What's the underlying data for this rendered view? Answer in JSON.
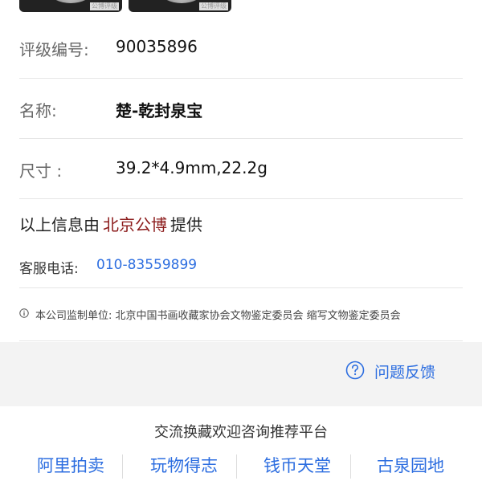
{
  "thumbnails": [
    {
      "watermark": "公博评级"
    },
    {
      "watermark": "公博评级"
    }
  ],
  "details": {
    "grade_label": "评级编号:",
    "grade_value": "90035896",
    "name_label": "名称:",
    "name_value": "楚-乾封泉宝",
    "size_label": "尺寸 :",
    "size_value": "39.2*4.9mm,22.2g"
  },
  "provider": {
    "prefix": "以上信息由",
    "org": "北京公博",
    "suffix": "提供"
  },
  "service": {
    "label": "客服电话:",
    "phone": "010-83559899"
  },
  "supervision": {
    "icon": "info-icon",
    "text": "本公司监制单位: 北京中国书画收藏家协会文物鉴定委员会 缩写文物鉴定委员会"
  },
  "feedback": {
    "icon": "question-circle-icon",
    "label": "问题反馈"
  },
  "footer": {
    "title": "交流换藏欢迎咨询推荐平台",
    "links": [
      "阿里拍卖",
      "玩物得志",
      "钱币天堂",
      "古泉园地"
    ]
  },
  "colors": {
    "link_blue": "#2d6ee0",
    "org_red": "#8b1a1a",
    "band_gray": "#f3f3f3"
  }
}
